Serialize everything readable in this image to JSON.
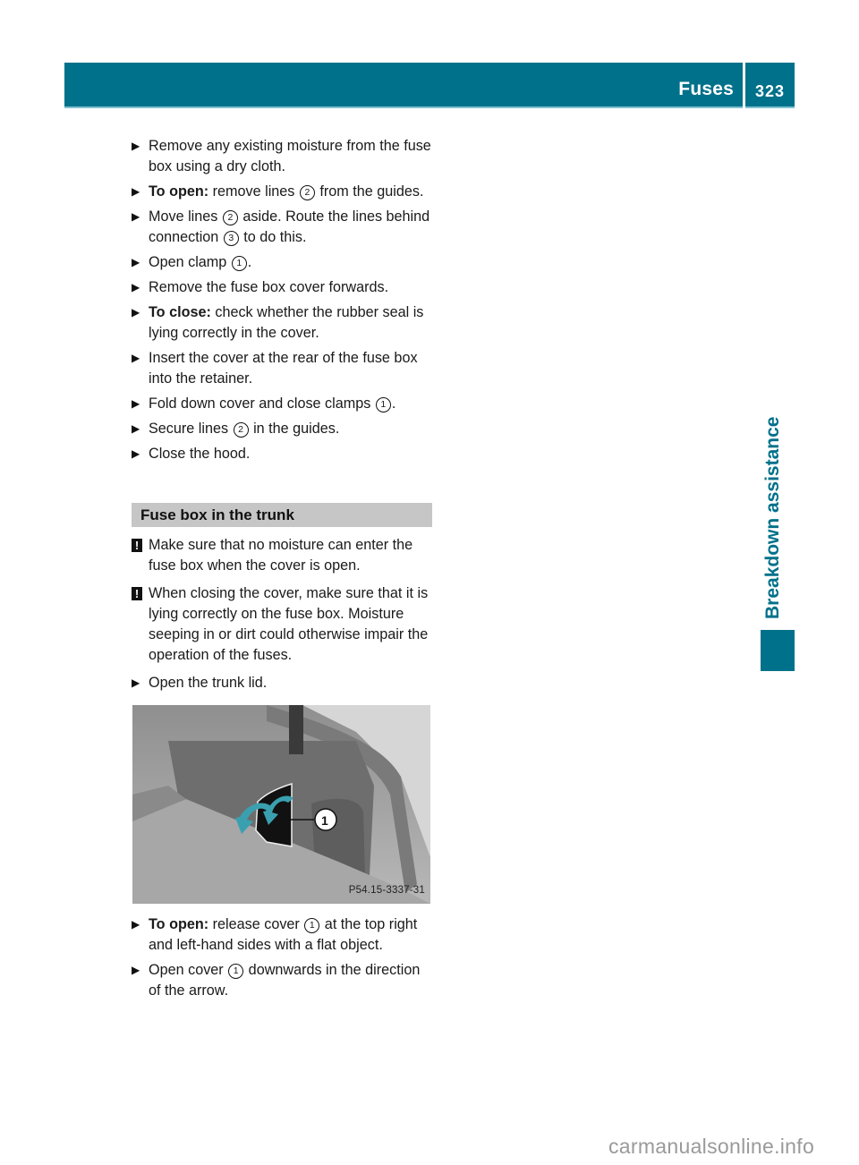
{
  "header": {
    "section_title": "Fuses",
    "page_number": "323",
    "accent_color": "#00718a"
  },
  "side_tab": {
    "label": "Breakdown assistance"
  },
  "steps_top": [
    {
      "bold": "",
      "parts": [
        "Remove any existing moisture from the fuse box using a dry cloth."
      ]
    },
    {
      "bold": "To open:",
      "parts": [
        " remove lines ",
        "2",
        " from the guides."
      ]
    },
    {
      "bold": "",
      "parts": [
        "Move lines ",
        "2",
        " aside. Route the lines behind connection ",
        "3",
        " to do this."
      ]
    },
    {
      "bold": "",
      "parts": [
        "Open clamp ",
        "1",
        "."
      ]
    },
    {
      "bold": "",
      "parts": [
        "Remove the fuse box cover forwards."
      ]
    },
    {
      "bold": "To close:",
      "parts": [
        " check whether the rubber seal is lying correctly in the cover."
      ]
    },
    {
      "bold": "",
      "parts": [
        "Insert the cover at the rear of the fuse box into the retainer."
      ]
    },
    {
      "bold": "",
      "parts": [
        "Fold down cover and close clamps ",
        "1",
        "."
      ]
    },
    {
      "bold": "",
      "parts": [
        "Secure lines ",
        "2",
        " in the guides."
      ]
    },
    {
      "bold": "",
      "parts": [
        "Close the hood."
      ]
    }
  ],
  "section": {
    "heading": "Fuse box in the trunk",
    "warnings": [
      "Make sure that no moisture can enter the fuse box when the cover is open.",
      "When closing the cover, make sure that it is lying correctly on the fuse box. Moisture seeping in or dirt could otherwise impair the operation of the fuses."
    ],
    "warning_icon": "!",
    "step_before_figure": "Open the trunk lid.",
    "figure": {
      "code": "P54.15-3337-31",
      "callout": "1",
      "description": "Open trunk with fuse box cover and arrows indicating opening direction"
    },
    "steps_after": [
      {
        "bold": "To open:",
        "parts": [
          " release cover ",
          "1",
          " at the top right and left-hand sides with a flat object."
        ]
      },
      {
        "bold": "",
        "parts": [
          "Open cover ",
          "1",
          " downwards in the direction of the arrow."
        ]
      }
    ]
  },
  "watermark": "carmanualsonline.info"
}
